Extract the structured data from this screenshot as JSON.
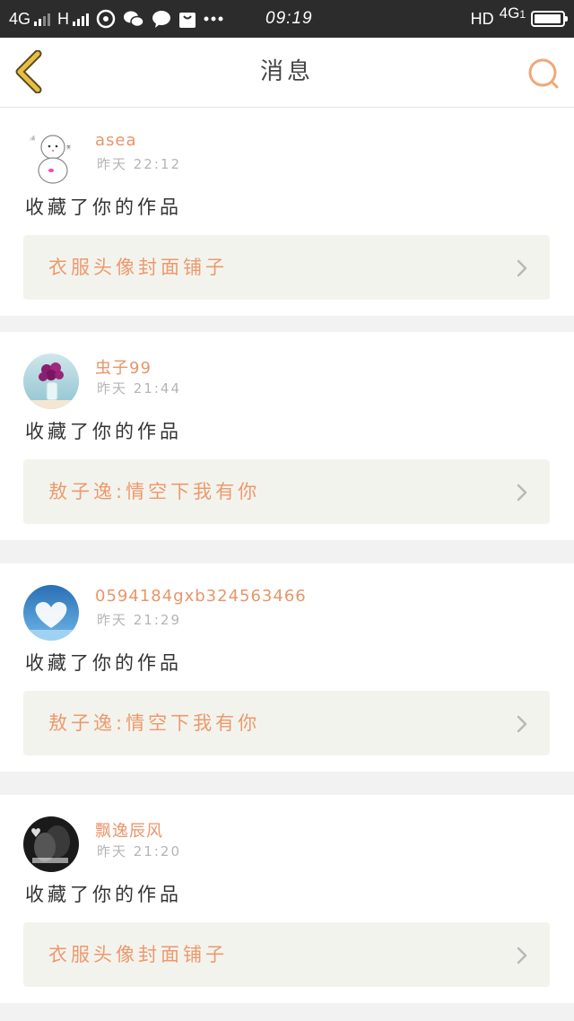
{
  "status_bar": {
    "network_left": "4G",
    "network_h": "H",
    "time": "09:19",
    "hd": "HD",
    "network_right": "4G",
    "network_right_sub": "1",
    "battery_level": 0.95
  },
  "nav": {
    "title": "消息"
  },
  "colors": {
    "accent": "#e8956a",
    "back_arrow": "#e0b43a",
    "search_icon": "#f0a77a",
    "work_box_bg": "#f3f3ee"
  },
  "messages": [
    {
      "user": "asea",
      "time": "昨天 22:12",
      "action": "收藏了你的作品",
      "work": "衣服头像封面铺子",
      "avatar_icon": "snowman-avatar"
    },
    {
      "user": "虫子99",
      "time": "昨天 21:44",
      "action": "收藏了你的作品",
      "work": "敖子逸:情空下我有你",
      "avatar_icon": "flower-vase-avatar"
    },
    {
      "user": "0594184gxb324563466",
      "time": "昨天 21:29",
      "action": "收藏了你的作品",
      "work": "敖子逸:情空下我有你",
      "avatar_icon": "heart-cloud-avatar"
    },
    {
      "user": "飘逸辰风",
      "time": "昨天 21:20",
      "action": "收藏了你的作品",
      "work": "衣服头像封面铺子",
      "avatar_icon": "couple-photo-avatar"
    }
  ]
}
